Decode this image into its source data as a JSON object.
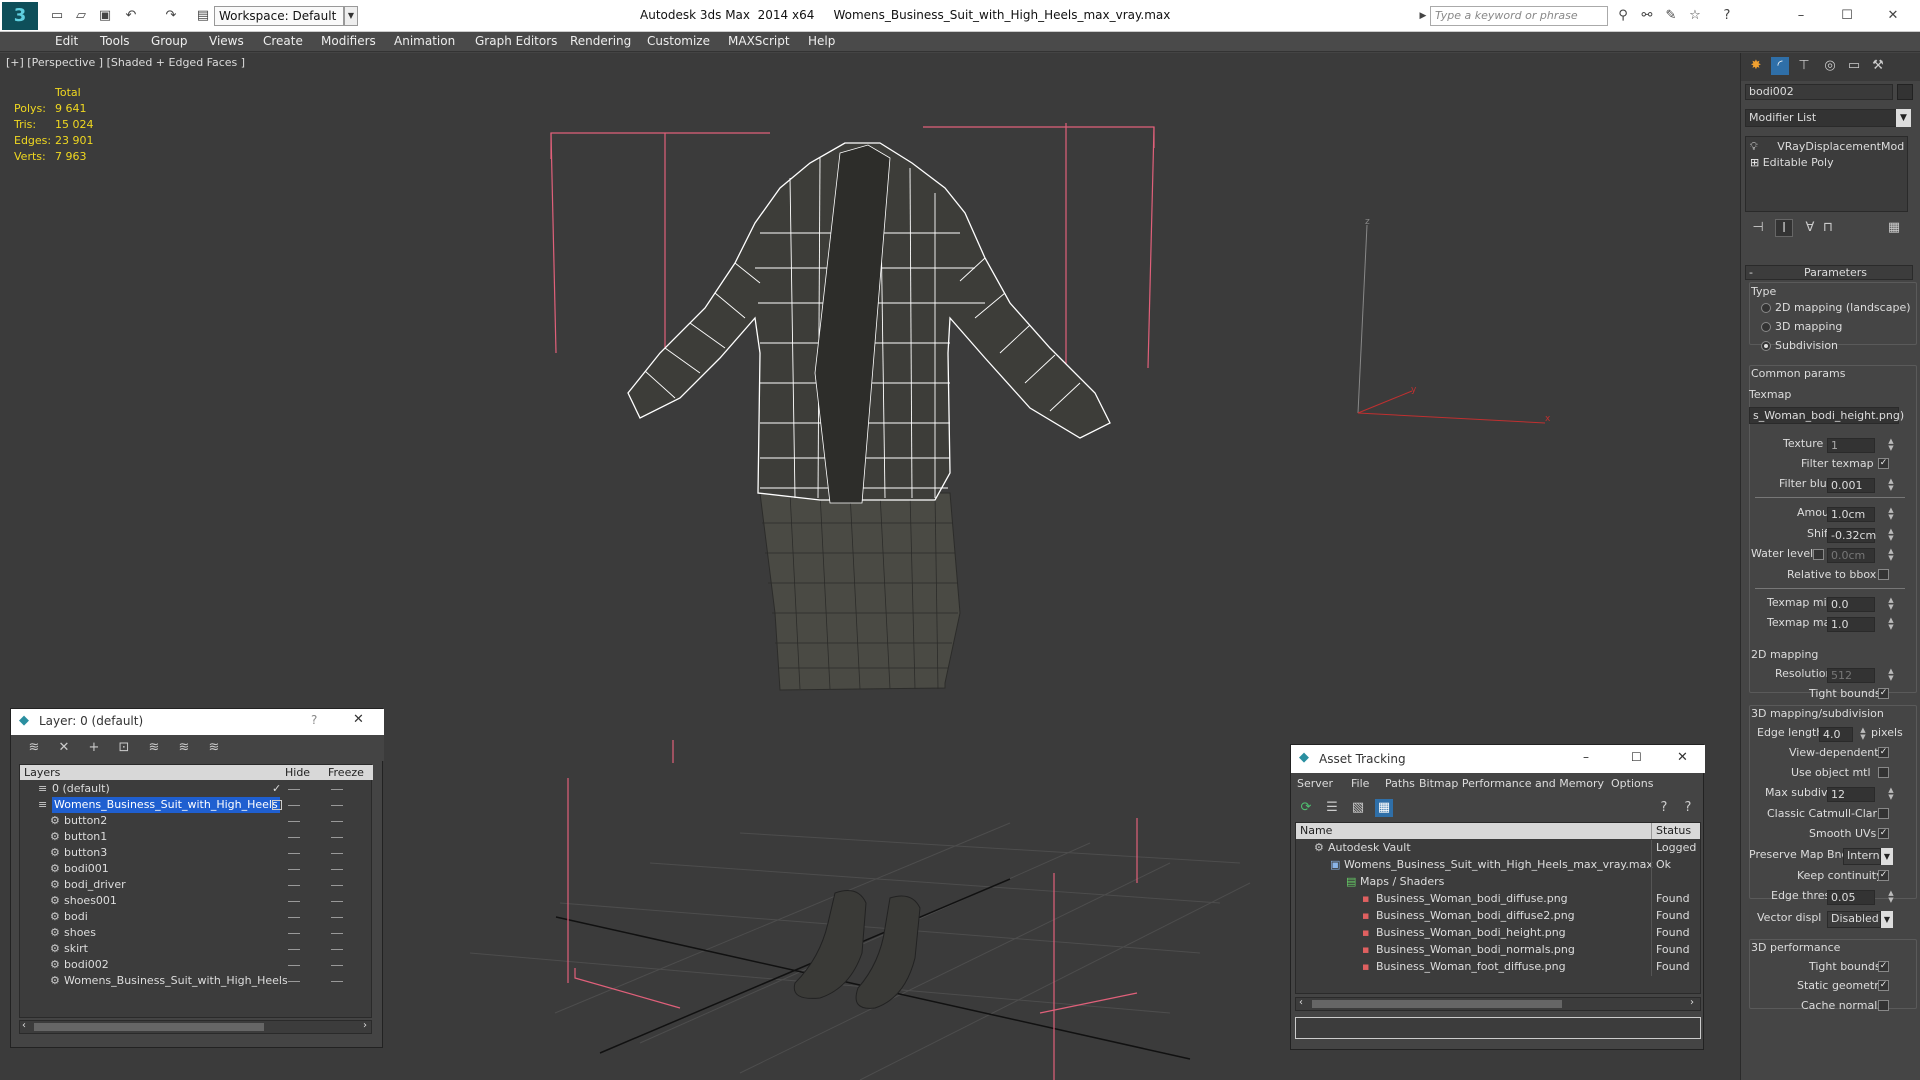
{
  "titlebar": {
    "workspace": "Workspace: Default",
    "app_name": "Autodesk 3ds Max  2014 x64",
    "file_name": "Womens_Business_Suit_with_High_Heels_max_vray.max",
    "search_placeholder": "Type a keyword or phrase"
  },
  "menu": [
    "Edit",
    "Tools",
    "Group",
    "Views",
    "Create",
    "Modifiers",
    "Animation",
    "Graph Editors",
    "Rendering",
    "Customize",
    "MAXScript",
    "Help"
  ],
  "viewport": {
    "label": "[+] [Perspective ] [Shaded + Edged Faces ]",
    "stats": {
      "header": "Total",
      "rows": [
        {
          "label": "Polys:",
          "value": "9 641"
        },
        {
          "label": "Tris:",
          "value": "15 024"
        },
        {
          "label": "Edges:",
          "value": "23 901"
        },
        {
          "label": "Verts:",
          "value": "7 963"
        }
      ]
    },
    "axis": {
      "x": "x",
      "y": "y",
      "z": "z"
    }
  },
  "command_panel": {
    "object_name": "bodi002",
    "modifier_list": "Modifier List",
    "stack": [
      "VRayDisplacementMod",
      "Editable Poly"
    ],
    "rollout_title": "Parameters",
    "type_group": "Type",
    "type_options": [
      {
        "label": "2D mapping (landscape)",
        "selected": false
      },
      {
        "label": "3D mapping",
        "selected": false
      },
      {
        "label": "Subdivision",
        "selected": true
      }
    ],
    "common_params": "Common params",
    "texmap_label": "Texmap",
    "texmap_value": "s_Woman_bodi_height.png)",
    "texture_chan_label": "Texture chan",
    "texture_chan_value": "1",
    "filter_texmap_label": "Filter texmap",
    "filter_blur_label": "Filter blur",
    "filter_blur_value": "0.001",
    "amount_label": "Amount",
    "amount_value": "1.0cm",
    "shift_label": "Shift",
    "shift_value": "-0.32cm",
    "water_level_label": "Water level",
    "water_level_value": "0.0cm",
    "relative_bbox_label": "Relative to bbox",
    "texmap_min_label": "Texmap min",
    "texmap_min_value": "0.0",
    "texmap_max_label": "Texmap max",
    "texmap_max_value": "1.0",
    "mapping2d_group": "2D mapping",
    "resolution_label": "Resolution",
    "resolution_value": "512",
    "tight_bounds_label": "Tight bounds",
    "mapping3d_group": "3D mapping/subdivision",
    "edge_length_label": "Edge length",
    "edge_length_value": "4.0",
    "pixels_label": "pixels",
    "view_dependent_label": "View-dependent",
    "use_object_mtl_label": "Use object mtl",
    "max_subdivs_label": "Max subdivs",
    "max_subdivs_value": "12",
    "classic_cc_label": "Classic Catmull-Clark",
    "smooth_uvs_label": "Smooth UVs",
    "preserve_map_label": "Preserve Map Bnd",
    "preserve_map_value": "Intern",
    "keep_continuity_label": "Keep continuity",
    "edge_thresh_label": "Edge thresh",
    "edge_thresh_value": "0.05",
    "vector_displ_label": "Vector displ",
    "vector_displ_value": "Disabled",
    "perf_group": "3D performance",
    "tight_bounds2_label": "Tight bounds",
    "static_geometry_label": "Static geometry",
    "cache_normals_label": "Cache normals"
  },
  "layer_window": {
    "title": "Layer: 0 (default)",
    "col_layers": "Layers",
    "col_hide": "Hide",
    "col_freeze": "Freeze",
    "rows": [
      {
        "name": "0 (default)",
        "level": 1,
        "selected": false
      },
      {
        "name": "Womens_Business_Suit_with_High_Heels",
        "level": 1,
        "selected": true
      },
      {
        "name": "button2",
        "level": 2,
        "selected": false
      },
      {
        "name": "button1",
        "level": 2,
        "selected": false
      },
      {
        "name": "button3",
        "level": 2,
        "selected": false
      },
      {
        "name": "bodi001",
        "level": 2,
        "selected": false
      },
      {
        "name": "bodi_driver",
        "level": 2,
        "selected": false
      },
      {
        "name": "shoes001",
        "level": 2,
        "selected": false
      },
      {
        "name": "bodi",
        "level": 2,
        "selected": false
      },
      {
        "name": "shoes",
        "level": 2,
        "selected": false
      },
      {
        "name": "skirt",
        "level": 2,
        "selected": false
      },
      {
        "name": "bodi002",
        "level": 2,
        "selected": false
      },
      {
        "name": "Womens_Business_Suit_with_High_Heels",
        "level": 2,
        "selected": false
      }
    ]
  },
  "asset_window": {
    "title": "Asset Tracking",
    "menu": [
      "Server",
      "File",
      "Paths",
      "Bitmap Performance and Memory",
      "Options"
    ],
    "col_name": "Name",
    "col_status": "Status",
    "rows": [
      {
        "name": "Autodesk Vault",
        "status": "Logged C",
        "level": 0
      },
      {
        "name": "Womens_Business_Suit_with_High_Heels_max_vray.max",
        "status": "Ok",
        "level": 1
      },
      {
        "name": "Maps / Shaders",
        "status": "",
        "level": 2
      },
      {
        "name": "Business_Woman_bodi_diffuse.png",
        "status": "Found",
        "level": 3
      },
      {
        "name": "Business_Woman_bodi_diffuse2.png",
        "status": "Found",
        "level": 3
      },
      {
        "name": "Business_Woman_bodi_height.png",
        "status": "Found",
        "level": 3
      },
      {
        "name": "Business_Woman_bodi_normals.png",
        "status": "Found",
        "level": 3
      },
      {
        "name": "Business_Woman_foot_diffuse.png",
        "status": "Found",
        "level": 3
      }
    ]
  },
  "colors": {
    "stats": "#f0d820",
    "selection": "#1f5fd0",
    "bbox": "#e0607a",
    "wire": "#ffffff"
  }
}
